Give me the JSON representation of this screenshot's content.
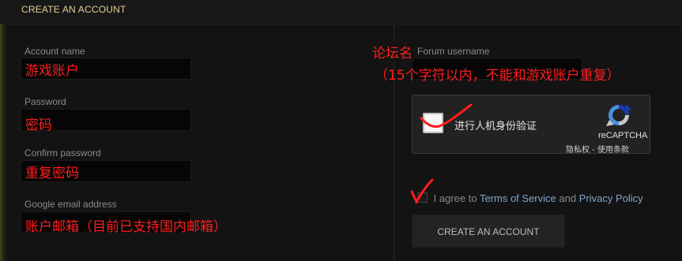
{
  "header": {
    "title": "CREATE AN ACCOUNT"
  },
  "left_form": {
    "account_name": {
      "label": "Account name",
      "annotation": "游戏账户"
    },
    "password": {
      "label": "Password",
      "annotation": "密码"
    },
    "confirm_password": {
      "label": "Confirm password",
      "annotation": "重复密码"
    },
    "email": {
      "label": "Google email address",
      "annotation": "账户邮箱（目前已支持国内邮箱）"
    }
  },
  "right_form": {
    "forum_username": {
      "label": "Forum username",
      "annotation_title": "论坛名",
      "annotation_note": "（15个字符以内，不能和游戏账户重复）"
    },
    "captcha": {
      "label": "进行人机身份验证",
      "brand": "reCAPTCHA",
      "privacy_link": "隐私权",
      "separator": " - ",
      "terms_link": "使用条款"
    },
    "agreement": {
      "prefix": "I agree to",
      "tos_link": "Terms of Service",
      "conjunction": "and",
      "privacy_link": "Privacy Policy"
    },
    "submit_label": "CREATE AN ACCOUNT"
  },
  "colors": {
    "accent_gold": "#e3cf93",
    "link_blue": "#7ea6cc",
    "annotation_red": "#ff1d1d"
  },
  "icons": [
    "recaptcha-logo-icon",
    "checkmark-annotation-icon"
  ]
}
